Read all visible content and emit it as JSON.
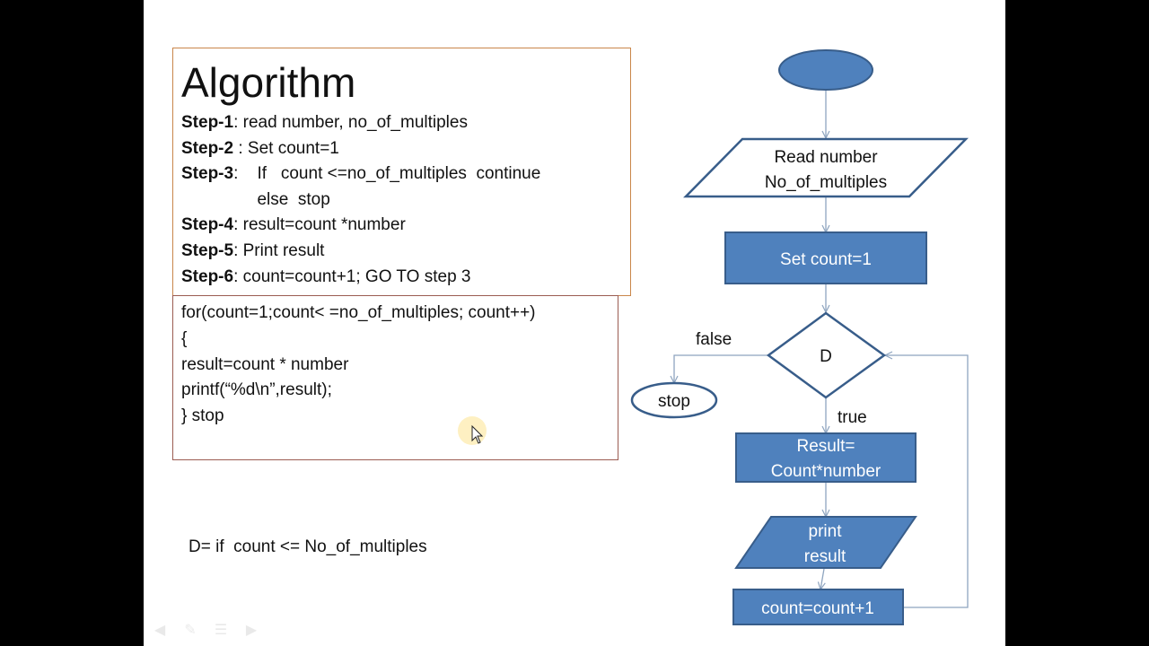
{
  "colors": {
    "shape_fill": "#4f81bd",
    "shape_stroke": "#385d8a",
    "connector": "#8ea4bf",
    "algo_border": "#c9864a",
    "code_border": "#9b5c52",
    "text": "#111111",
    "shape_text": "#ffffff"
  },
  "algorithm": {
    "title": "Algorithm",
    "steps": [
      {
        "label": "Step-1",
        "text": ": read number, no_of_multiples"
      },
      {
        "label": "Step-2",
        "text": " : Set count=1"
      },
      {
        "label": "Step-3",
        "text": ":    If   count <=no_of_multiples  continue"
      },
      {
        "label": "",
        "text": "                else  stop"
      },
      {
        "label": "Step-4",
        "text": ": result=count *number"
      },
      {
        "label": "Step-5",
        "text": ": Print result"
      },
      {
        "label": "Step-6",
        "text": ": count=count+1; GO TO step 3"
      }
    ]
  },
  "code": {
    "lines": [
      "for(count=1;count< =no_of_multiples; count++)",
      "{",
      "result=count * number",
      "printf(“%d\\n”,result);",
      "} stop"
    ]
  },
  "definition": "D= if  count <= No_of_multiples",
  "flowchart": {
    "start": "",
    "input": [
      "Read number",
      "No_of_multiples"
    ],
    "init": "Set count=1",
    "decision": "D",
    "false_label": "false",
    "true_label": "true",
    "stop": "stop",
    "process": [
      "Result=",
      "Count*number"
    ],
    "output": [
      "print",
      "result"
    ],
    "increment": "count=count+1"
  },
  "nav_icons": [
    "back-arrow-icon",
    "pen-icon",
    "menu-icon",
    "forward-arrow-icon"
  ]
}
